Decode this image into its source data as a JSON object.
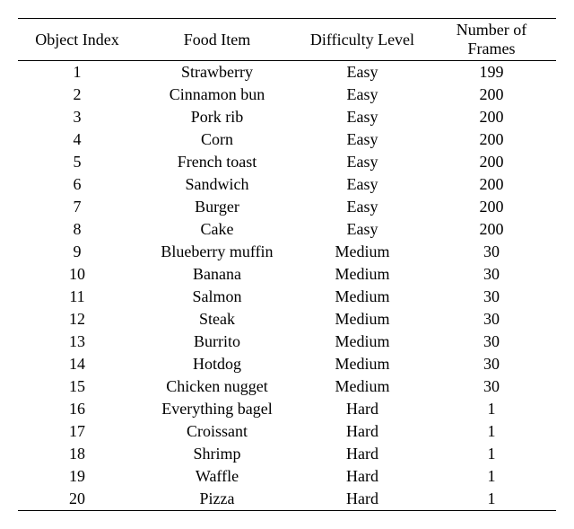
{
  "headers": {
    "object_index": "Object Index",
    "food_item": "Food Item",
    "difficulty_level": "Difficulty Level",
    "number_of_frames": "Number of Frames"
  },
  "rows": [
    {
      "idx": "1",
      "food": "Strawberry",
      "diff": "Easy",
      "frames": "199"
    },
    {
      "idx": "2",
      "food": "Cinnamon bun",
      "diff": "Easy",
      "frames": "200"
    },
    {
      "idx": "3",
      "food": "Pork rib",
      "diff": "Easy",
      "frames": "200"
    },
    {
      "idx": "4",
      "food": "Corn",
      "diff": "Easy",
      "frames": "200"
    },
    {
      "idx": "5",
      "food": "French toast",
      "diff": "Easy",
      "frames": "200"
    },
    {
      "idx": "6",
      "food": "Sandwich",
      "diff": "Easy",
      "frames": "200"
    },
    {
      "idx": "7",
      "food": "Burger",
      "diff": "Easy",
      "frames": "200"
    },
    {
      "idx": "8",
      "food": "Cake",
      "diff": "Easy",
      "frames": "200"
    },
    {
      "idx": "9",
      "food": "Blueberry muffin",
      "diff": "Medium",
      "frames": "30"
    },
    {
      "idx": "10",
      "food": "Banana",
      "diff": "Medium",
      "frames": "30"
    },
    {
      "idx": "11",
      "food": "Salmon",
      "diff": "Medium",
      "frames": "30"
    },
    {
      "idx": "12",
      "food": "Steak",
      "diff": "Medium",
      "frames": "30"
    },
    {
      "idx": "13",
      "food": "Burrito",
      "diff": "Medium",
      "frames": "30"
    },
    {
      "idx": "14",
      "food": "Hotdog",
      "diff": "Medium",
      "frames": "30"
    },
    {
      "idx": "15",
      "food": "Chicken nugget",
      "diff": "Medium",
      "frames": "30"
    },
    {
      "idx": "16",
      "food": "Everything bagel",
      "diff": "Hard",
      "frames": "1"
    },
    {
      "idx": "17",
      "food": "Croissant",
      "diff": "Hard",
      "frames": "1"
    },
    {
      "idx": "18",
      "food": "Shrimp",
      "diff": "Hard",
      "frames": "1"
    },
    {
      "idx": "19",
      "food": "Waffle",
      "diff": "Hard",
      "frames": "1"
    },
    {
      "idx": "20",
      "food": "Pizza",
      "diff": "Hard",
      "frames": "1"
    }
  ]
}
